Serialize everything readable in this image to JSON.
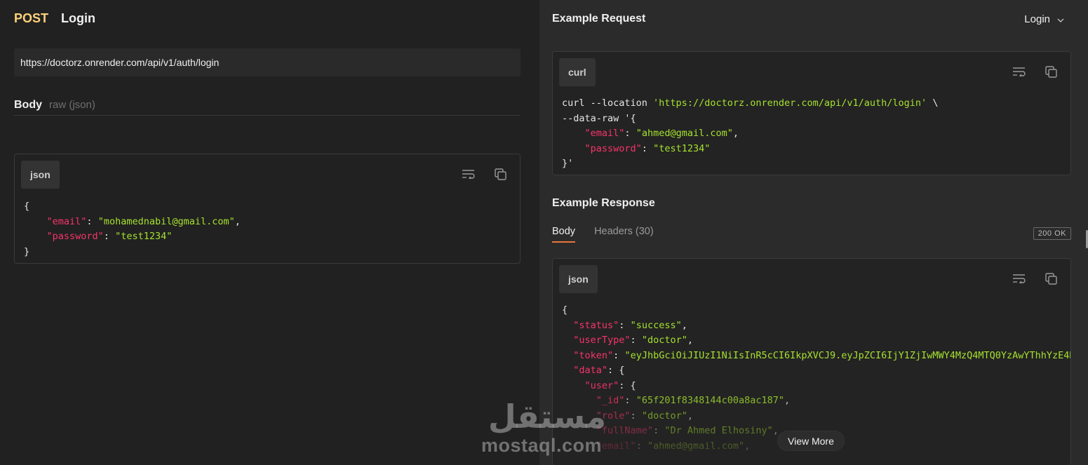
{
  "request": {
    "method": "POST",
    "name": "Login",
    "url": "https://doctorz.onrender.com/api/v1/auth/login",
    "body_label": "Body",
    "body_type": "raw (json)",
    "lang": "json",
    "code_lines": [
      [
        {
          "t": "{",
          "c": "p"
        }
      ],
      [
        {
          "t": "    ",
          "c": "p"
        },
        {
          "t": "\"email\"",
          "c": "k"
        },
        {
          "t": ": ",
          "c": "p"
        },
        {
          "t": "\"mohamednabil@gmail.com\"",
          "c": "s"
        },
        {
          "t": ",",
          "c": "p"
        }
      ],
      [
        {
          "t": "    ",
          "c": "p"
        },
        {
          "t": "\"password\"",
          "c": "k"
        },
        {
          "t": ": ",
          "c": "p"
        },
        {
          "t": "\"test1234\"",
          "c": "s"
        }
      ],
      [
        {
          "t": "}",
          "c": "p"
        }
      ]
    ]
  },
  "example_request": {
    "title": "Example Request",
    "selected_example": "Login",
    "lang": "curl",
    "code_lines": [
      [
        {
          "t": "curl --location ",
          "c": "p"
        },
        {
          "t": "'https://doctorz.onrender.com/api/v1/auth/login'",
          "c": "s"
        },
        {
          "t": " \\",
          "c": "p"
        }
      ],
      [
        {
          "t": "--data-raw ",
          "c": "p"
        },
        {
          "t": "'{",
          "c": "p"
        }
      ],
      [
        {
          "t": "    ",
          "c": "p"
        },
        {
          "t": "\"email\"",
          "c": "k"
        },
        {
          "t": ": ",
          "c": "p"
        },
        {
          "t": "\"ahmed@gmail.com\"",
          "c": "s"
        },
        {
          "t": ",",
          "c": "p"
        }
      ],
      [
        {
          "t": "    ",
          "c": "p"
        },
        {
          "t": "\"password\"",
          "c": "k"
        },
        {
          "t": ": ",
          "c": "p"
        },
        {
          "t": "\"test1234\"",
          "c": "s"
        }
      ],
      [
        {
          "t": "}'",
          "c": "p"
        }
      ]
    ]
  },
  "example_response": {
    "title": "Example Response",
    "tabs": [
      "Body",
      "Headers (30)"
    ],
    "status": "200 OK",
    "lang": "json",
    "view_more": "View More",
    "code_lines": [
      [
        {
          "t": "{",
          "c": "p"
        }
      ],
      [
        {
          "t": "  ",
          "c": "p"
        },
        {
          "t": "\"status\"",
          "c": "k"
        },
        {
          "t": ": ",
          "c": "p"
        },
        {
          "t": "\"success\"",
          "c": "s"
        },
        {
          "t": ",",
          "c": "p"
        }
      ],
      [
        {
          "t": "  ",
          "c": "p"
        },
        {
          "t": "\"userType\"",
          "c": "k"
        },
        {
          "t": ": ",
          "c": "p"
        },
        {
          "t": "\"doctor\"",
          "c": "s"
        },
        {
          "t": ",",
          "c": "p"
        }
      ],
      [
        {
          "t": "  ",
          "c": "p"
        },
        {
          "t": "\"token\"",
          "c": "k"
        },
        {
          "t": ": ",
          "c": "p"
        },
        {
          "t": "\"eyJhbGciOiJIUzI1NiIsInR5cCI6IkpXVCJ9.eyJpZCI6IjY1ZjIwMWY4MzQ4MTQ0YzAwYThhYzE4N",
          "c": "s"
        }
      ],
      [
        {
          "t": "  ",
          "c": "p"
        },
        {
          "t": "\"data\"",
          "c": "k"
        },
        {
          "t": ": {",
          "c": "p"
        }
      ],
      [
        {
          "t": "    ",
          "c": "p"
        },
        {
          "t": "\"user\"",
          "c": "k"
        },
        {
          "t": ": {",
          "c": "p"
        }
      ],
      [
        {
          "t": "      ",
          "c": "p"
        },
        {
          "t": "\"_id\"",
          "c": "k"
        },
        {
          "t": ": ",
          "c": "p"
        },
        {
          "t": "\"65f201f8348144c00a8ac187\"",
          "c": "s"
        },
        {
          "t": ",",
          "c": "p"
        }
      ],
      [
        {
          "t": "      ",
          "c": "p"
        },
        {
          "t": "\"role\"",
          "c": "k"
        },
        {
          "t": ": ",
          "c": "p"
        },
        {
          "t": "\"doctor\"",
          "c": "s"
        },
        {
          "t": ",",
          "c": "p"
        }
      ],
      [
        {
          "t": "      ",
          "c": "p"
        },
        {
          "t": "\"fullName\"",
          "c": "k"
        },
        {
          "t": ": ",
          "c": "p"
        },
        {
          "t": "\"Dr Ahmed Elhosiny\"",
          "c": "s"
        },
        {
          "t": ",",
          "c": "p"
        }
      ],
      [
        {
          "t": "      ",
          "c": "p"
        },
        {
          "t": "\"email\"",
          "c": "k"
        },
        {
          "t": ": ",
          "c": "p"
        },
        {
          "t": "\"ahmed@gmail.com\"",
          "c": "s"
        },
        {
          "t": ",",
          "c": "p"
        }
      ]
    ]
  },
  "icons": {
    "wrap": "wrap-lines-icon",
    "copy": "copy-icon",
    "chevron": "chevron-down-icon"
  },
  "watermark": {
    "logo_text": "مستقل",
    "site": "mostaql.com"
  },
  "colors": {
    "method": "#ffd27a",
    "json_key": "#f7346b",
    "json_string": "#a6e22e",
    "tab_underline": "#e8763c"
  }
}
